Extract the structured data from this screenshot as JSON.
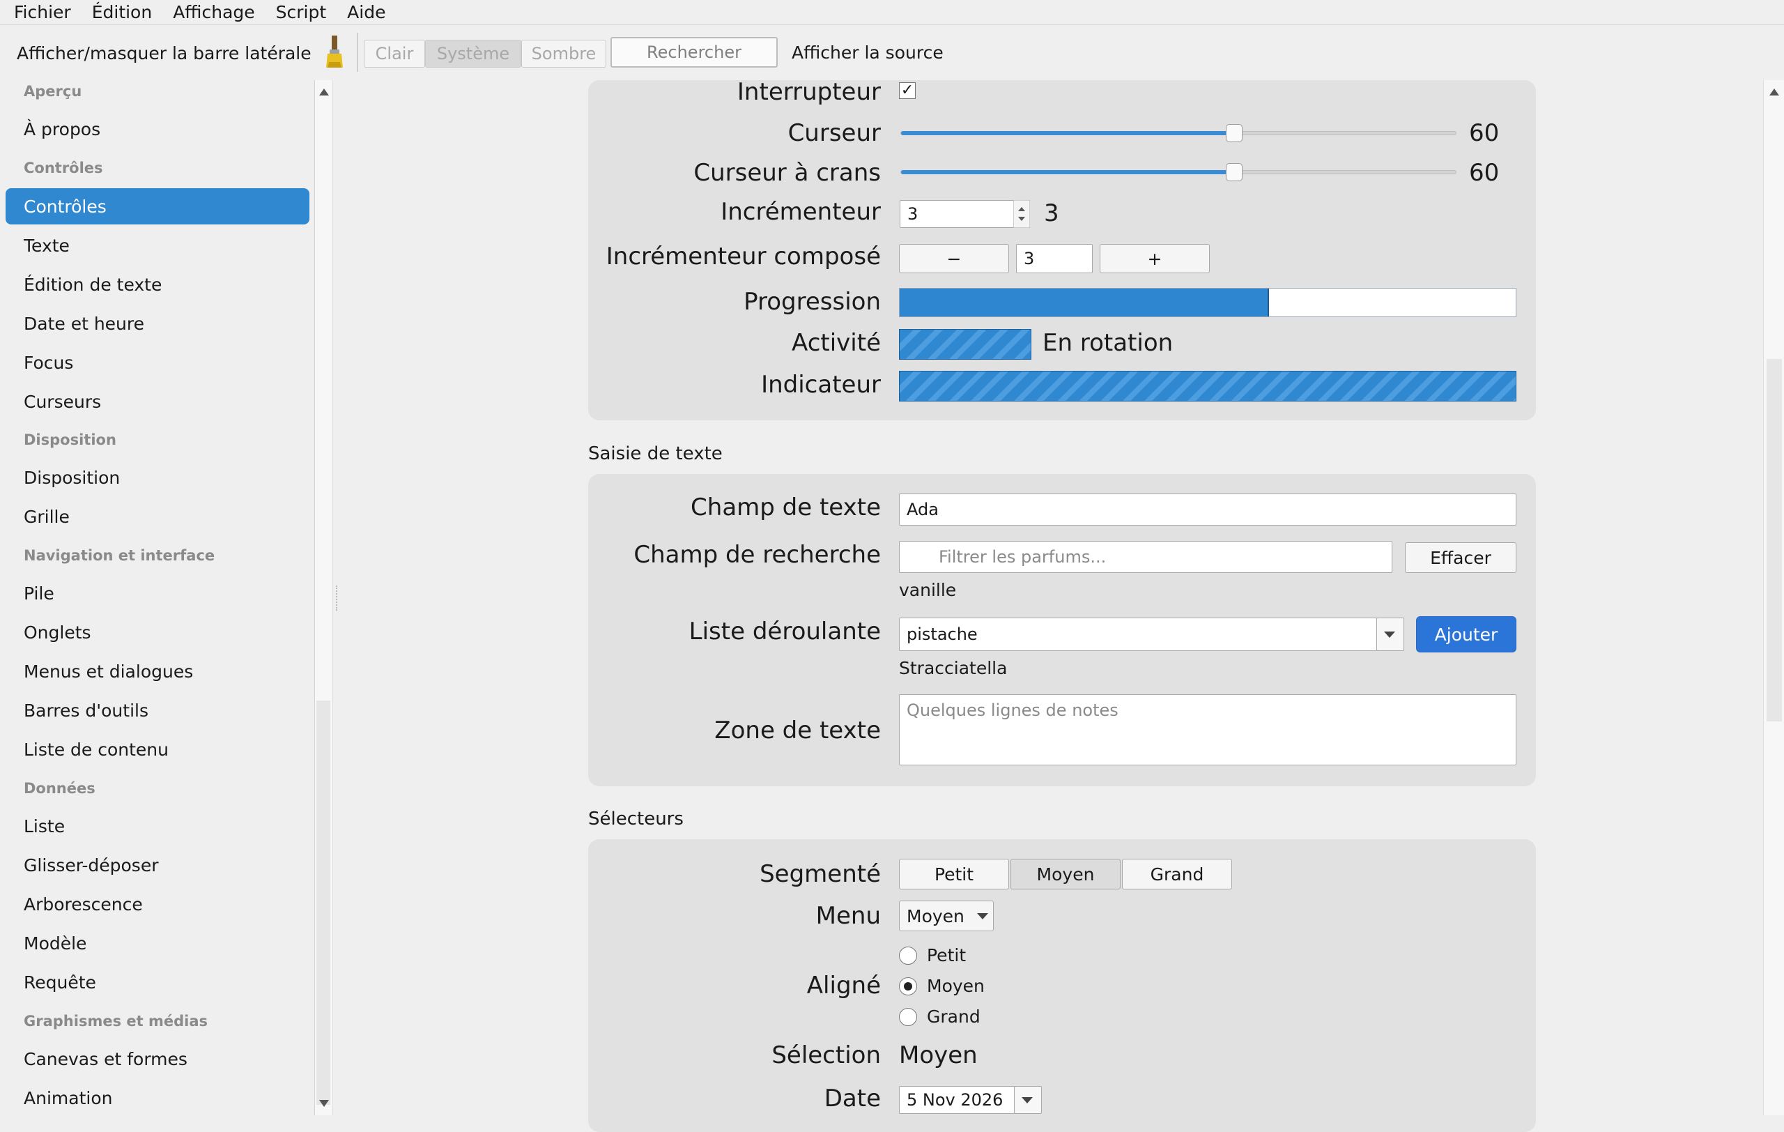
{
  "menubar": [
    "Fichier",
    "Édition",
    "Affichage",
    "Script",
    "Aide"
  ],
  "toolbar": {
    "sidebar_toggle": "Afficher/masquer la barre latérale",
    "theme": [
      "Clair",
      "Système",
      "Sombre"
    ],
    "theme_selected": "Système",
    "search_label": "Rechercher",
    "source_label": "Afficher la source"
  },
  "sidebar": {
    "sections": [
      {
        "header": "Aperçu",
        "items": [
          "À propos"
        ]
      },
      {
        "header": "Contrôles",
        "items": [
          "Contrôles",
          "Texte",
          "Édition de texte",
          "Date et heure",
          "Focus",
          "Curseurs"
        ]
      },
      {
        "header": "Disposition",
        "items": [
          "Disposition",
          "Grille"
        ]
      },
      {
        "header": "Navigation et interface",
        "items": [
          "Pile",
          "Onglets",
          "Menus et dialogues",
          "Barres d'outils",
          "Liste de contenu"
        ]
      },
      {
        "header": "Données",
        "items": [
          "Liste",
          "Glisser-déposer",
          "Arborescence",
          "Modèle",
          "Requête"
        ]
      },
      {
        "header": "Graphismes et médias",
        "items": [
          "Canevas et formes",
          "Animation"
        ]
      }
    ],
    "selected": "Contrôles"
  },
  "controls": {
    "switch_label": "Interrupteur",
    "switch_on": true,
    "slider_label": "Curseur",
    "slider_value": "60",
    "slider_fraction": 0.6,
    "stepped_label": "Curseur à crans",
    "stepped_value": "60",
    "stepped_fraction": 0.6,
    "stepper_label": "Incrémenteur",
    "stepper_value": "3",
    "stepper_readout": "3",
    "compound_label": "Incrémenteur composé",
    "compound_minus": "−",
    "compound_value": "3",
    "compound_plus": "+",
    "progress_label": "Progression",
    "progress_fraction": 0.6,
    "activity_label": "Activité",
    "activity_text": "En rotation",
    "indicator_label": "Indicateur"
  },
  "text_input": {
    "section_title": "Saisie de texte",
    "field_label": "Champ de texte",
    "field_value": "Ada",
    "search_label": "Champ de recherche",
    "search_placeholder": "Filtrer les parfums...",
    "clear_button": "Effacer",
    "search_result": "vanille",
    "combo_label": "Liste déroulante",
    "combo_value": "pistache",
    "add_button": "Ajouter",
    "combo_result": "Stracciatella",
    "textarea_label": "Zone de texte",
    "textarea_placeholder": "Quelques lignes de notes"
  },
  "pickers": {
    "section_title": "Sélecteurs",
    "segmented_label": "Segmenté",
    "segments": [
      "Petit",
      "Moyen",
      "Grand"
    ],
    "segment_selected": "Moyen",
    "menu_label": "Menu",
    "menu_value": "Moyen",
    "inline_label": "Aligné",
    "radio_options": [
      "Petit",
      "Moyen",
      "Grand"
    ],
    "radio_selected": "Moyen",
    "selection_label": "Sélection",
    "selection_value": "Moyen",
    "date_label": "Date",
    "date_value": "5 Nov 2026"
  }
}
